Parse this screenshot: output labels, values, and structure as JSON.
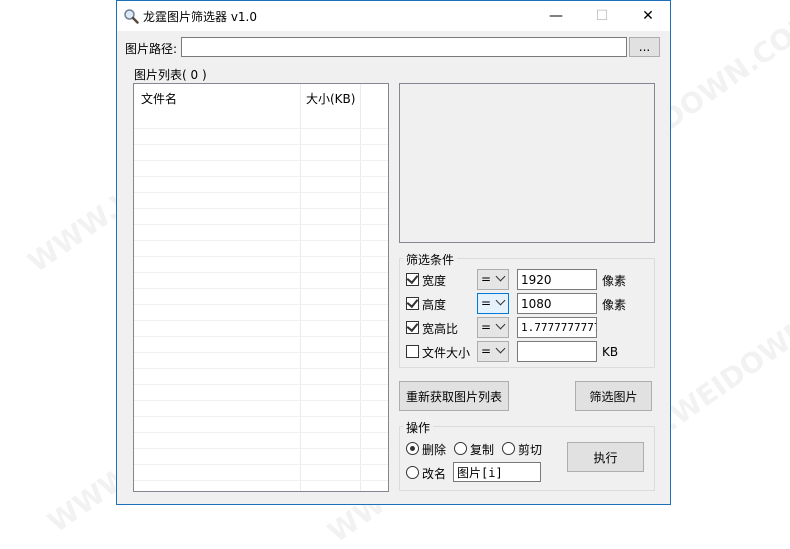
{
  "window": {
    "title": "龙霆图片筛选器 v1.0",
    "min_glyph": "—",
    "max_glyph": "☐",
    "close_glyph": "✕"
  },
  "path": {
    "label": "图片路径:",
    "value": "",
    "browse_label": "..."
  },
  "list": {
    "group_title": "图片列表( 0 )",
    "col_filename": "文件名",
    "col_size": "大小(KB)"
  },
  "filter": {
    "group_title": "筛选条件",
    "width": {
      "label": "宽度",
      "checked": true,
      "op": "=",
      "value": "1920",
      "unit": "像素"
    },
    "height": {
      "label": "高度",
      "checked": true,
      "op": "=",
      "value": "1080",
      "unit": "像素"
    },
    "ratio": {
      "label": "宽高比",
      "checked": true,
      "op": "=",
      "value": "1.77777777777"
    },
    "filesize": {
      "label": "文件大小",
      "checked": false,
      "op": "=",
      "value": "",
      "unit": "KB"
    }
  },
  "buttons": {
    "refresh": "重新获取图片列表",
    "filter": "筛选图片",
    "execute": "执行"
  },
  "ops": {
    "group_title": "操作",
    "delete": "删除",
    "copy": "复制",
    "cut": "剪切",
    "rename": "改名",
    "rename_pattern": "图片[i]",
    "selected": "delete"
  },
  "colors": {
    "accent": "#0078d7",
    "window_bg": "#f0f0f0"
  }
}
